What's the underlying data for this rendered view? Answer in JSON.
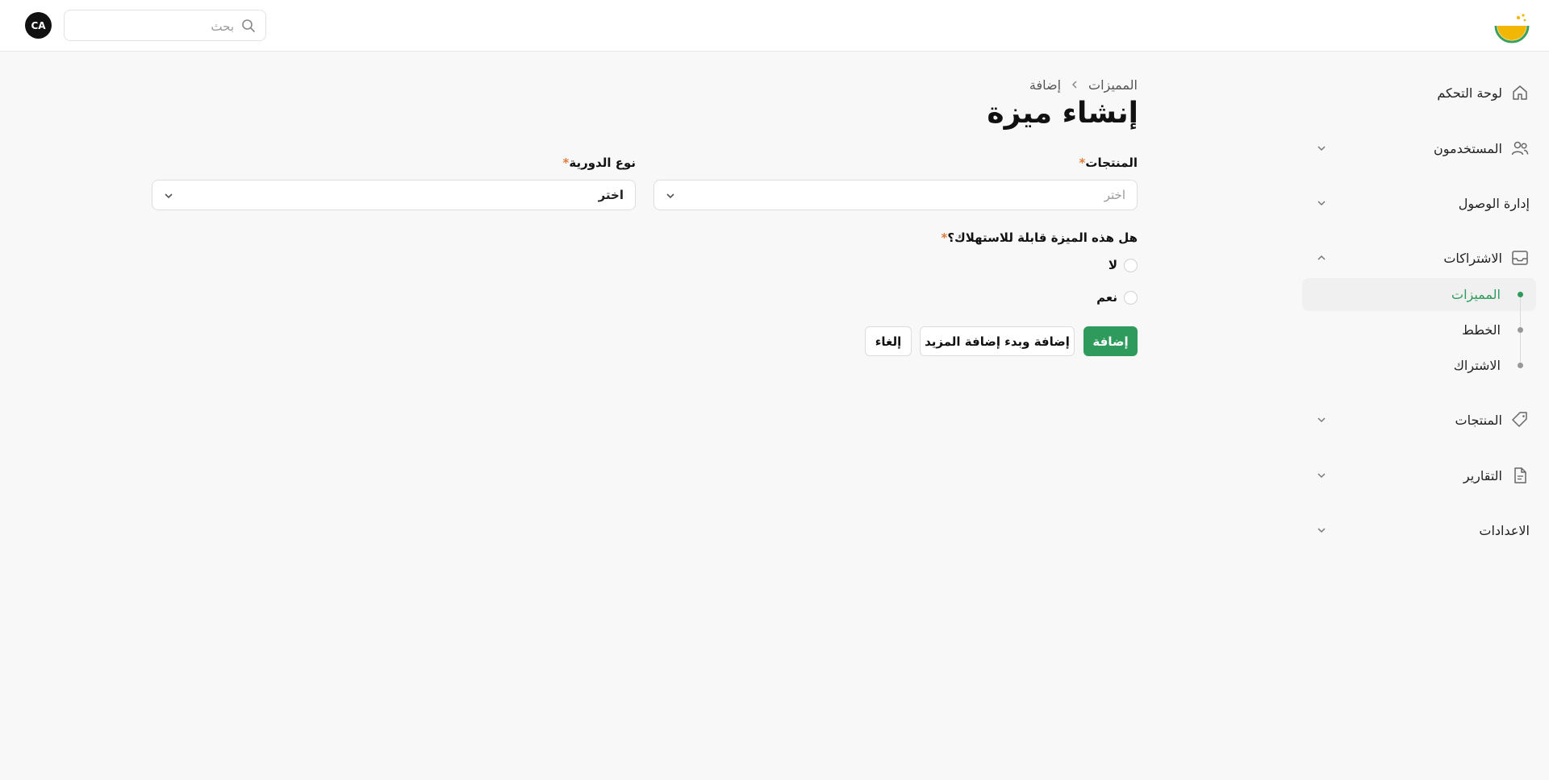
{
  "header": {
    "search_placeholder": "بحث",
    "avatar_initials": "CA"
  },
  "sidebar": {
    "items": [
      {
        "label": "لوحة التحكم"
      },
      {
        "label": "المستخدمون"
      },
      {
        "label": "إدارة الوصول"
      },
      {
        "label": "الاشتراكات"
      },
      {
        "label": "المنتجات"
      },
      {
        "label": "التقارير"
      },
      {
        "label": "الاعدادات"
      }
    ],
    "subscriptions_subitems": [
      {
        "label": "المميزات"
      },
      {
        "label": "الخطط"
      },
      {
        "label": "الاشتراك"
      }
    ]
  },
  "breadcrumb": {
    "parent": "المميزات",
    "current": "إضافة"
  },
  "page": {
    "title": "إنشاء ميزة"
  },
  "form": {
    "products_label": "المنتجات",
    "products_placeholder": "اختر",
    "cycle_type_label": "نوع الدورية",
    "cycle_type_value": "اختر",
    "consumable_question": "هل هذه الميزة قابلة للاستهلاك؟",
    "option_no": "لا",
    "option_yes": "نعم",
    "required_mark": "*"
  },
  "actions": {
    "add": "إضافة",
    "add_and_more": "إضافة وبدء إضافة المزيد",
    "cancel": "إلغاء"
  },
  "colors": {
    "accent": "#2e9a5c",
    "required": "#e07b39"
  }
}
